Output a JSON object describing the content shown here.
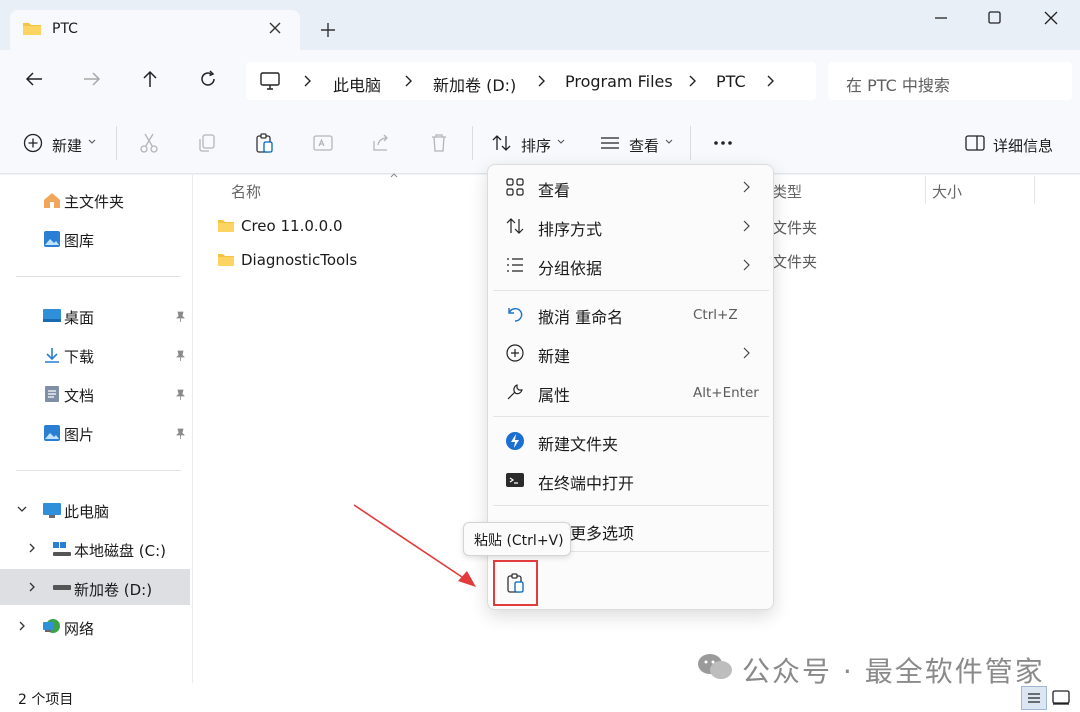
{
  "window": {
    "tab_title": "PTC",
    "colors": {
      "accent": "#0067c0",
      "folder": "#f5c342",
      "annotation": "#e23b3b"
    }
  },
  "breadcrumb": [
    "此电脑",
    "新加卷 (D:)",
    "Program Files",
    "PTC"
  ],
  "search": {
    "placeholder": "在 PTC 中搜索"
  },
  "toolbar": {
    "new_label": "新建",
    "sort_label": "排序",
    "view_label": "查看",
    "details_label": "详细信息"
  },
  "sidebar": {
    "home": "主文件夹",
    "gallery": "图库",
    "desktop": "桌面",
    "downloads": "下载",
    "documents": "文档",
    "pictures": "图片",
    "this_pc": "此电脑",
    "drive_c": "本地磁盘 (C:)",
    "drive_d": "新加卷 (D:)",
    "network": "网络"
  },
  "columns": {
    "name": "名称",
    "type": "类型",
    "size": "大小"
  },
  "files": [
    {
      "name": "Creo 11.0.0.0",
      "type": "文件夹"
    },
    {
      "name": "DiagnosticTools",
      "type": "文件夹"
    }
  ],
  "context_menu": {
    "view": "查看",
    "sort_by": "排序方式",
    "group_by": "分组依据",
    "undo": "撤消 重命名",
    "undo_shortcut": "Ctrl+Z",
    "new": "新建",
    "properties": "属性",
    "properties_shortcut": "Alt+Enter",
    "new_folder": "新建文件夹",
    "open_terminal": "在终端中打开",
    "more_options": "显示更多选项"
  },
  "tooltip": "粘贴 (Ctrl+V)",
  "status": {
    "item_count": "2 个项目"
  },
  "watermark": "公众号 · 最全软件管家"
}
